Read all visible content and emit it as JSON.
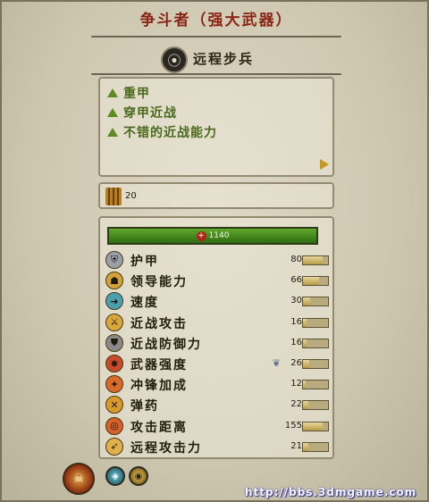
{
  "window": {
    "title": "争斗者（强大武器）"
  },
  "unit": {
    "name": "远程步兵",
    "icon": "unit-type-icon"
  },
  "traits": {
    "items": [
      "重甲",
      "穿甲近战",
      "不错的近战能力"
    ],
    "more_icon": "arrow-right-icon"
  },
  "ammo": {
    "icon": "arrows-quiver-icon",
    "value": "20"
  },
  "health": {
    "value": "1140",
    "icon": "plus-icon"
  },
  "stats": [
    {
      "label": "护甲",
      "value": "80",
      "icon": "armor-icon",
      "fill": 0.8,
      "color": "#9aa0a8"
    },
    {
      "label": "领导能力",
      "value": "66",
      "icon": "leadership-icon",
      "fill": 0.66,
      "color": "#d4a23a"
    },
    {
      "label": "速度",
      "value": "30",
      "icon": "speed-icon",
      "fill": 0.3,
      "color": "#4aa0b0"
    },
    {
      "label": "近战攻击",
      "value": "16",
      "icon": "melee-attack-icon",
      "fill": 0.16,
      "color": "#d8a83a"
    },
    {
      "label": "近战防御力",
      "value": "16",
      "icon": "melee-defence-icon",
      "fill": 0.16,
      "color": "#8a8a8a"
    },
    {
      "label": "武器强度",
      "value": "26",
      "icon": "weapon-strength-icon",
      "fill": 0.26,
      "color": "#c84a2a",
      "bonus_icon": "bonus-bird-icon"
    },
    {
      "label": "冲锋加成",
      "value": "12",
      "icon": "charge-bonus-icon",
      "fill": 0.12,
      "color": "#d86a2a"
    },
    {
      "label": "弹药",
      "value": "22",
      "icon": "ammunition-icon",
      "fill": 0.22,
      "color": "#d89a2a"
    },
    {
      "label": "攻击距离",
      "value": "155",
      "icon": "range-icon",
      "fill": 0.78,
      "color": "#d8602a"
    },
    {
      "label": "远程攻击力",
      "value": "21",
      "icon": "missile-damage-icon",
      "fill": 0.21,
      "color": "#e0b04a"
    }
  ],
  "buttons": [
    {
      "name": "unit-portrait-button",
      "icon": "portrait-icon"
    },
    {
      "name": "ability-button",
      "icon": "shield-ability-icon"
    },
    {
      "name": "view-button",
      "icon": "eye-icon"
    }
  ],
  "watermark": "http://bbs.3dmgame.com"
}
